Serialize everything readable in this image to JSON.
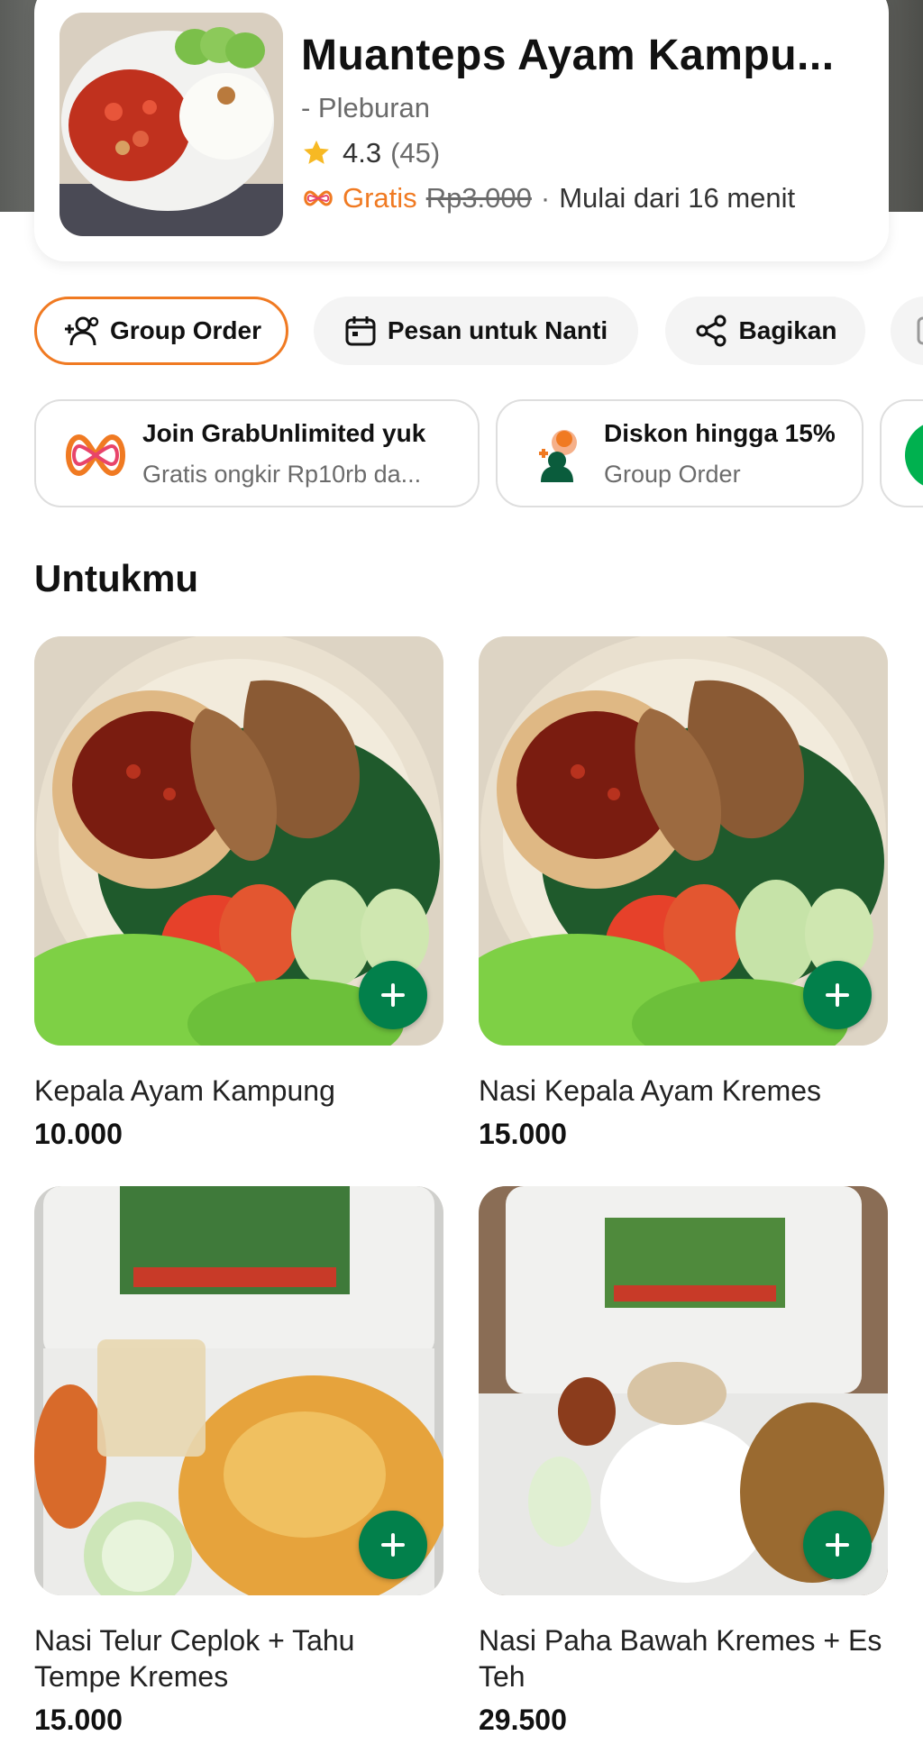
{
  "merchant": {
    "name": "Muanteps Ayam Kampu...",
    "area": "- Pleburan",
    "rating": "4.3",
    "rating_count": "(45)",
    "delivery_free": "Gratis",
    "delivery_original": "Rp3.000",
    "delivery_separator": "·",
    "delivery_eta": "Mulai dari 16 menit"
  },
  "actions": {
    "group_order": "Group Order",
    "order_later": "Pesan untuk Nanti",
    "share": "Bagikan"
  },
  "promos": [
    {
      "title": "Join GrabUnlimited yuk",
      "subtitle": "Gratis ongkir Rp10rb da..."
    },
    {
      "title": "Diskon hingga 15%",
      "subtitle": "Group Order"
    }
  ],
  "section": {
    "title": "Untukmu"
  },
  "menu": [
    {
      "name": "Kepala Ayam Kampung",
      "price": "10.000"
    },
    {
      "name": "Nasi Kepala Ayam Kremes",
      "price": "15.000"
    },
    {
      "name": "Nasi Telur Ceplok + Tahu Tempe Kremes",
      "price": "15.000"
    },
    {
      "name": "Nasi Paha Bawah Kremes + Es Teh",
      "price": "29.500"
    }
  ],
  "colors": {
    "accent_orange": "#f07a22",
    "add_button_green": "#02804b",
    "brand_green": "#00b14f"
  },
  "icons": {
    "rating": "star-icon",
    "unlimited": "grabunlimited-icon",
    "group_order": "group-users-icon",
    "order_later": "calendar-icon",
    "share": "share-icon",
    "add": "plus-icon"
  }
}
